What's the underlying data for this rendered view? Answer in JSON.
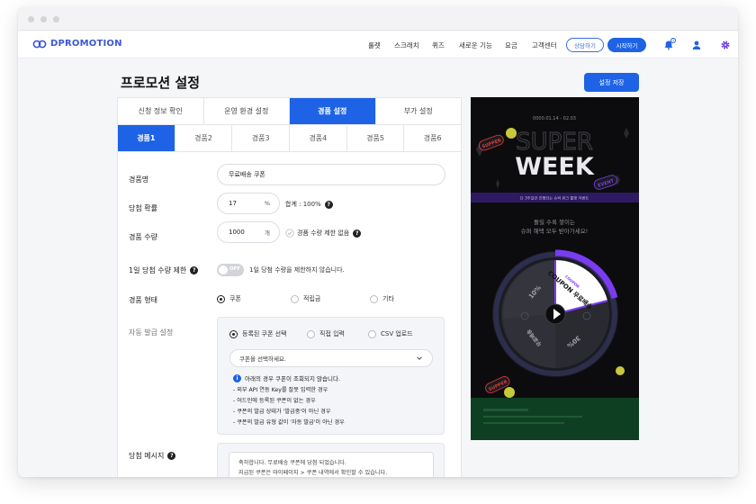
{
  "header": {
    "logo_text": "DPROMOTION",
    "nav": [
      "룰렛",
      "스크래치",
      "퀴즈",
      "새로운 기능",
      "요금",
      "고객센터"
    ],
    "consult_label": "상담하기",
    "start_label": "시작하기",
    "notification_count": "1"
  },
  "page": {
    "title": "프로모션 설정",
    "save_label": "설정 저장"
  },
  "tabs": [
    "신청 정보 확인",
    "운영 환경 설정",
    "경품 설정",
    "부가 설정"
  ],
  "active_tab": 2,
  "prize_tabs": [
    "경품1",
    "경품2",
    "경품3",
    "경품4",
    "경품5",
    "경품6"
  ],
  "active_prize_tab": 0,
  "form": {
    "name_label": "경품명",
    "name_value": "무료배송 쿠폰",
    "prob_label": "당첨 확률",
    "prob_value": "17",
    "prob_unit": "%",
    "prob_total": "합계 : 100%",
    "qty_label": "경품 수량",
    "qty_value": "1000",
    "qty_unit": "개",
    "qty_nolimit": "경품 수량 제한 없음",
    "daily_label": "1일 당첨 수량 제한",
    "daily_toggle": "OFF",
    "daily_desc": "1일 당첨 수량을 제한하지 않습니다.",
    "type_label": "경품 형태",
    "type_options": [
      "쿠폰",
      "적립금",
      "기타"
    ],
    "type_selected": 0,
    "auto_label": "자동 발급 설정",
    "auto_options": [
      "등록된 쿠폰 선택",
      "직접 입력",
      "CSV 업로드"
    ],
    "auto_selected": 0,
    "coupon_select_placeholder": "쿠폰을 선택하세요.",
    "info_title": "아래의 경우 쿠폰이 조회되지 않습니다.",
    "info_lines": [
      "- 외부 API 연동 Key를 잘못 입력한 경우",
      "- 어드민에 등록된 쿠폰이 없는 경우",
      "- 쿠폰의 발급 상태가 '발급중'이 아닌 경우",
      "- 쿠폰의 발급 유형 값이 '자동 발급'이 아닌 경우"
    ],
    "message_label": "당첨 메시지",
    "message_lines": [
      "축하합니다. 무료배송 쿠폰에 당첨 되었습니다.",
      "지급된 쿠폰은 마이페이지 > 쿠폰 내역에서 확인할 수 있습니다."
    ]
  },
  "preview": {
    "period": "0000.01.14 - 02.03",
    "headline_1": "SUPER",
    "headline_2": "WEEK",
    "sticker_1": "SUPPER",
    "sticker_2": "EVENT",
    "sticker_3": "SUPPER",
    "banner_text": "단 3주일만 진행되는 슈퍼 위크 룰렛 이벤트",
    "subtitle_1": "돌릴 수록 쌓이는",
    "subtitle_2": "슈퍼 혜택 모두 받아가세요!",
    "wheel_segments": [
      "COUPON 무료배송",
      "10%",
      "30%",
      "무료배송"
    ],
    "wheel_coupon_word": "COUPON",
    "accent_color": "#7a3cf0"
  }
}
